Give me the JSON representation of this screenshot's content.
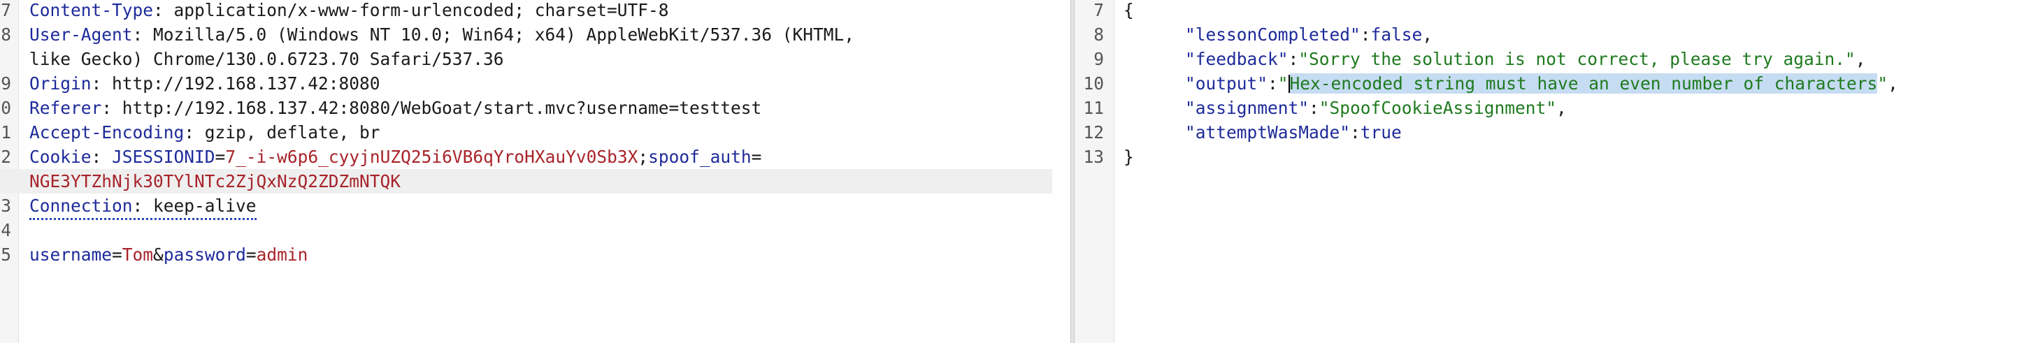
{
  "request": {
    "lines": [
      {
        "num": "7",
        "key": "Content-Type",
        "sep": ": ",
        "value": "application/x-www-form-urlencoded; charset=UTF-8"
      },
      {
        "num": "8",
        "key": "User-Agent",
        "sep": ": ",
        "value": "Mozilla/5.0 (Windows NT 10.0; Win64; x64) AppleWebKit/537.36 (KHTML,"
      },
      {
        "num": "",
        "value": "like Gecko) Chrome/130.0.6723.70 Safari/537.36"
      },
      {
        "num": "9",
        "key": "Origin",
        "sep": ": ",
        "value": "http://192.168.137.42:8080"
      },
      {
        "num": "0",
        "key": "Referer",
        "sep": ": ",
        "value": "http://192.168.137.42:8080/WebGoat/start.mvc?username=testtest"
      },
      {
        "num": "1",
        "key": "Accept-Encoding",
        "sep": ": ",
        "value": "gzip, deflate, br"
      },
      {
        "num": "2",
        "key": "Cookie",
        "sep": ": ",
        "c1_name": "JSESSIONID",
        "c1_value": "7_-i-w6p6_cyyjnUZQ25i6VB6qYroHXauYv0Sb3X",
        "c2_name": "spoof_auth",
        "c2_value_a": "",
        "c2_value_b": "NGE3YTZhNjk30TYlNTc2ZjQxNzQ2ZDZmNTQK"
      },
      {
        "num": "3",
        "key": "Connection",
        "sep": ": ",
        "value": "keep-alive"
      },
      {
        "num": "4"
      },
      {
        "num": "5",
        "p1_name": "username",
        "p1_value": "Tom",
        "p2_name": "password",
        "p2_value": "admin"
      }
    ]
  },
  "response": {
    "lines": [
      {
        "num": "7",
        "text": "{"
      },
      {
        "num": "8",
        "key": "\"lessonCompleted\"",
        "value": "false"
      },
      {
        "num": "9",
        "key": "\"feedback\"",
        "value": "\"Sorry the solution is not correct, please try again.\""
      },
      {
        "num": "10",
        "key": "\"output\"",
        "value_open": "\"",
        "value_sel": "Hex-encoded string must have an even number of characters",
        "value_close": "\""
      },
      {
        "num": "11",
        "key": "\"assignment\"",
        "value": "\"SpoofCookieAssignment\""
      },
      {
        "num": "12",
        "key": "\"attemptWasMade\"",
        "value": "true"
      },
      {
        "num": "13",
        "text": "}"
      }
    ]
  }
}
